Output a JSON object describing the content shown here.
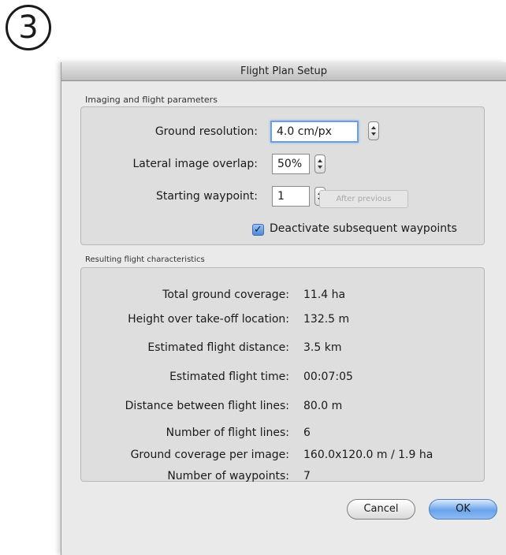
{
  "step_number": "3",
  "dialog": {
    "title": "Flight Plan Setup"
  },
  "imaging": {
    "group_label": "Imaging and flight parameters",
    "ground_resolution_label": "Ground resolution:",
    "ground_resolution_value": "4.0 cm/px",
    "lateral_overlap_label": "Lateral image overlap:",
    "lateral_overlap_value": "50%",
    "starting_waypoint_label": "Starting waypoint:",
    "starting_waypoint_value": "1",
    "after_previous_label": "After previous",
    "deactivate_label": "Deactivate subsequent waypoints",
    "deactivate_checked": true
  },
  "results": {
    "group_label": "Resulting flight characteristics",
    "rows": [
      {
        "label": "Total ground coverage:",
        "value": "11.4 ha"
      },
      {
        "label": "Height over take-off location:",
        "value": "132.5 m"
      },
      {
        "label": "Estimated flight distance:",
        "value": "3.5 km"
      },
      {
        "label": "Estimated flight time:",
        "value": "00:07:05"
      },
      {
        "label": "Distance between flight lines:",
        "value": "80.0 m"
      },
      {
        "label": "Number of flight lines:",
        "value": "6"
      },
      {
        "label": "Ground coverage per image:",
        "value": "160.0x120.0 m / 1.9 ha"
      },
      {
        "label": "Number of waypoints:",
        "value": "7"
      }
    ]
  },
  "buttons": {
    "cancel": "Cancel",
    "ok": "OK"
  },
  "colors": {
    "dialog_background": "#eaeaea",
    "groupbox_background": "#dedede",
    "focus_ring": "#6d9ee0",
    "default_button": "#6aa3ea"
  }
}
